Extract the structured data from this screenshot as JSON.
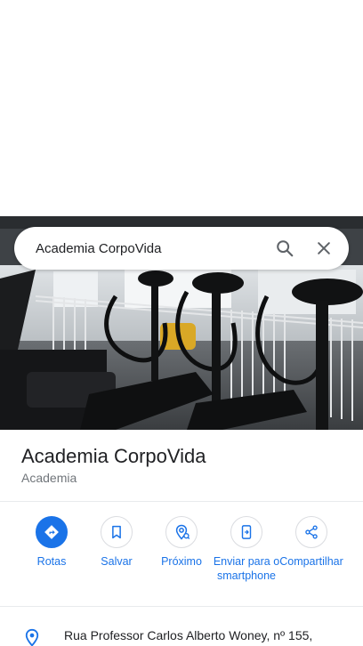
{
  "search": {
    "query": "Academia CorpoVida"
  },
  "place": {
    "name": "Academia CorpoVida",
    "category": "Academia"
  },
  "actions": [
    {
      "label": "Rotas",
      "icon": "directions-icon"
    },
    {
      "label": "Salvar",
      "icon": "bookmark-icon"
    },
    {
      "label": "Próximo",
      "icon": "nearby-icon"
    },
    {
      "label": "Enviar para o smartphone",
      "icon": "send-to-phone-icon"
    },
    {
      "label": "Compartilhar",
      "icon": "share-icon"
    }
  ],
  "address": {
    "text": "Rua Professor Carlos Alberto Woney, nº 155,"
  },
  "colors": {
    "accent": "#1a73e8",
    "text": "#202124",
    "secondary": "#70757a"
  }
}
